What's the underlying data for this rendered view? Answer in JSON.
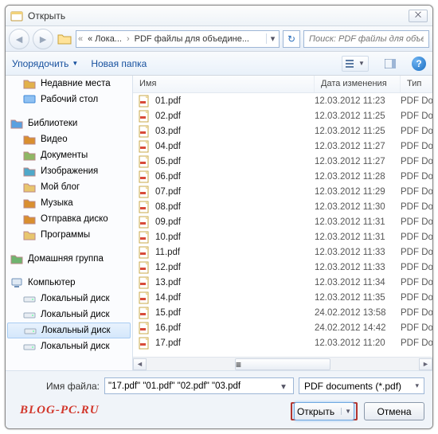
{
  "dialog": {
    "title": "Открыть",
    "close_glyph": "⨉"
  },
  "address": {
    "crumb1": "« Лока...",
    "crumb2": "PDF файлы для объедине...",
    "refresh_glyph": "↻"
  },
  "search": {
    "placeholder": "Поиск: PDF файлы для объед..."
  },
  "toolbar": {
    "organize": "Упорядочить",
    "newfolder": "Новая папка",
    "help_glyph": "?"
  },
  "columns": {
    "name": "Имя",
    "date": "Дата изменения",
    "type": "Тип"
  },
  "sidebar": {
    "items": [
      {
        "label": "Недавние места",
        "icon": "recent"
      },
      {
        "label": "Рабочий стол",
        "icon": "desktop"
      },
      {
        "label": "",
        "sep": true
      },
      {
        "label": "Библиотеки",
        "icon": "libraries",
        "top": true
      },
      {
        "label": "Видео",
        "icon": "video"
      },
      {
        "label": "Документы",
        "icon": "docs"
      },
      {
        "label": "Изображения",
        "icon": "images"
      },
      {
        "label": "Мой блог",
        "icon": "folder"
      },
      {
        "label": "Музыка",
        "icon": "music"
      },
      {
        "label": "Отправка диско",
        "icon": "send"
      },
      {
        "label": "Программы",
        "icon": "folder"
      },
      {
        "label": "",
        "sep": true
      },
      {
        "label": "Домашняя группа",
        "icon": "homegroup",
        "top": true
      },
      {
        "label": "",
        "sep": true
      },
      {
        "label": "Компьютер",
        "icon": "computer",
        "top": true
      },
      {
        "label": "Локальный диск",
        "icon": "drive"
      },
      {
        "label": "Локальный диск",
        "icon": "drive"
      },
      {
        "label": "Локальный диск",
        "icon": "drive",
        "sel": true
      },
      {
        "label": "Локальный диск",
        "icon": "drive"
      }
    ]
  },
  "files": [
    {
      "name": "01.pdf",
      "date": "12.03.2012 11:23",
      "type": "PDF Docu"
    },
    {
      "name": "02.pdf",
      "date": "12.03.2012 11:25",
      "type": "PDF Docu"
    },
    {
      "name": "03.pdf",
      "date": "12.03.2012 11:25",
      "type": "PDF Docu"
    },
    {
      "name": "04.pdf",
      "date": "12.03.2012 11:27",
      "type": "PDF Docu"
    },
    {
      "name": "05.pdf",
      "date": "12.03.2012 11:27",
      "type": "PDF Docu"
    },
    {
      "name": "06.pdf",
      "date": "12.03.2012 11:28",
      "type": "PDF Docu"
    },
    {
      "name": "07.pdf",
      "date": "12.03.2012 11:29",
      "type": "PDF Docu"
    },
    {
      "name": "08.pdf",
      "date": "12.03.2012 11:30",
      "type": "PDF Docu"
    },
    {
      "name": "09.pdf",
      "date": "12.03.2012 11:31",
      "type": "PDF Docu"
    },
    {
      "name": "10.pdf",
      "date": "12.03.2012 11:31",
      "type": "PDF Docu"
    },
    {
      "name": "11.pdf",
      "date": "12.03.2012 11:33",
      "type": "PDF Docu"
    },
    {
      "name": "12.pdf",
      "date": "12.03.2012 11:33",
      "type": "PDF Docu"
    },
    {
      "name": "13.pdf",
      "date": "12.03.2012 11:34",
      "type": "PDF Docu"
    },
    {
      "name": "14.pdf",
      "date": "12.03.2012 11:35",
      "type": "PDF Docu"
    },
    {
      "name": "15.pdf",
      "date": "24.02.2012 13:58",
      "type": "PDF Docu"
    },
    {
      "name": "16.pdf",
      "date": "24.02.2012 14:42",
      "type": "PDF Docu"
    },
    {
      "name": "17.pdf",
      "date": "12.03.2012 11:20",
      "type": "PDF Docu"
    }
  ],
  "footer": {
    "filename_label": "Имя файла:",
    "filename_value": "\"17.pdf\" \"01.pdf\" \"02.pdf\" \"03.pdf",
    "filter": "PDF documents (*.pdf)",
    "open": "Открыть",
    "cancel": "Отмена"
  },
  "watermark": "BLOG-PC.RU"
}
